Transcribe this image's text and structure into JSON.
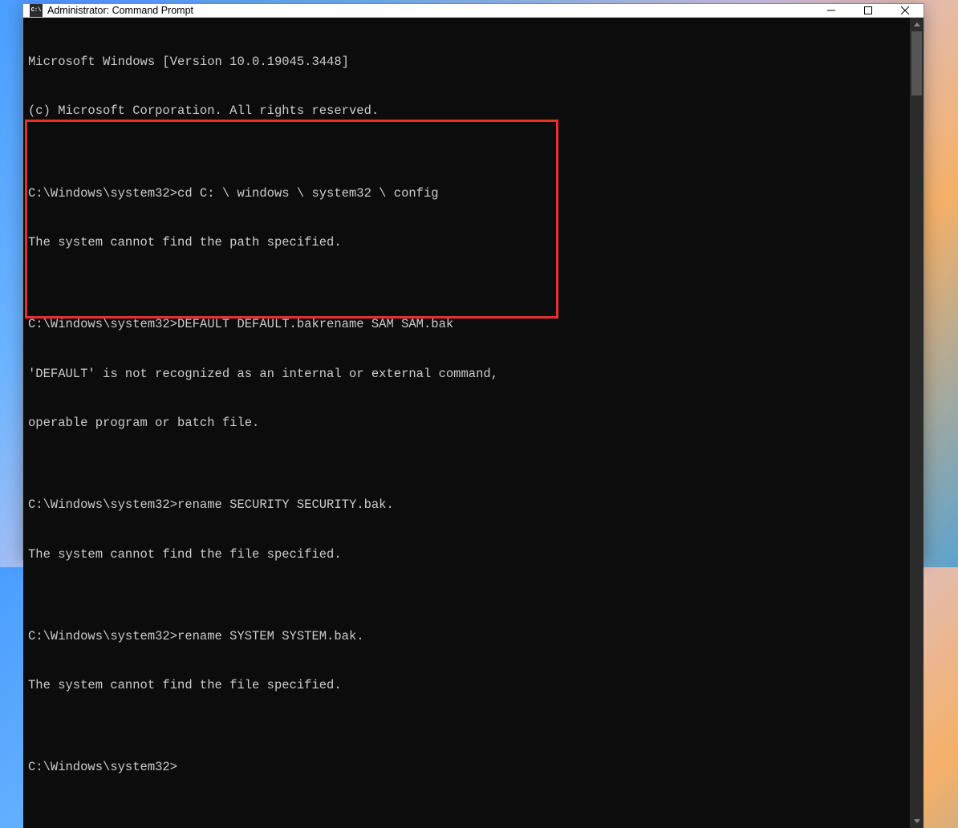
{
  "titlebar": {
    "icon_text": "C:\\",
    "title": "Administrator: Command Prompt"
  },
  "terminal": {
    "lines": [
      "Microsoft Windows [Version 10.0.19045.3448]",
      "(c) Microsoft Corporation. All rights reserved.",
      "",
      "C:\\Windows\\system32>cd C: \\ windows \\ system32 \\ config",
      "The system cannot find the path specified.",
      "",
      "C:\\Windows\\system32>DEFAULT DEFAULT.bakrename SAM SAM.bak",
      "'DEFAULT' is not recognized as an internal or external command,",
      "operable program or batch file.",
      "",
      "C:\\Windows\\system32>rename SECURITY SECURITY.bak.",
      "The system cannot find the file specified.",
      "",
      "C:\\Windows\\system32>rename SYSTEM SYSTEM.bak.",
      "The system cannot find the file specified.",
      "",
      "C:\\Windows\\system32>"
    ]
  },
  "highlight": {
    "color": "#e53030"
  }
}
